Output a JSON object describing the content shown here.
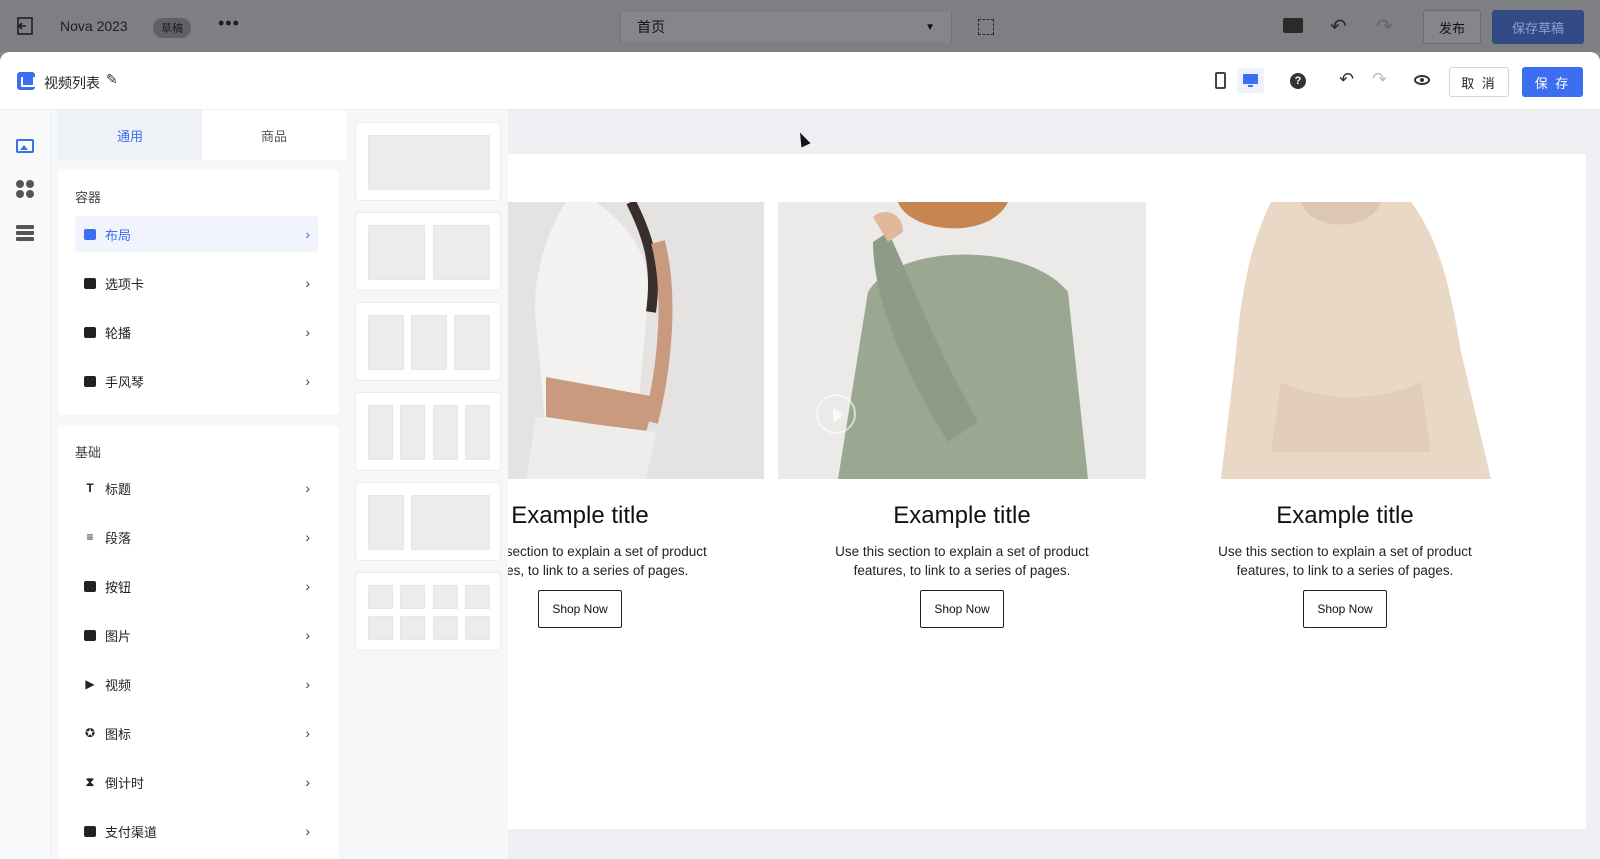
{
  "topbar": {
    "app_title": "Nova 2023",
    "draft_badge": "草稿",
    "more": "•••",
    "page_select": "首页",
    "publish": "发布",
    "save_draft": "保存草稿"
  },
  "panel_header": {
    "title": "视频列表",
    "cancel": "取 消",
    "save": "保 存"
  },
  "tabs": [
    {
      "label": "通用",
      "active": true
    },
    {
      "label": "商品",
      "active": false
    }
  ],
  "groups": [
    {
      "title": "容器",
      "items": [
        {
          "label": "布局",
          "icon": "layout-icon",
          "selected": true
        },
        {
          "label": "选项卡",
          "icon": "tabs-icon",
          "selected": false
        },
        {
          "label": "轮播",
          "icon": "carousel-icon",
          "selected": false
        },
        {
          "label": "手风琴",
          "icon": "accordion-icon",
          "selected": false
        }
      ]
    },
    {
      "title": "基础",
      "items": [
        {
          "label": "标题",
          "icon": "heading-icon"
        },
        {
          "label": "段落",
          "icon": "paragraph-icon"
        },
        {
          "label": "按钮",
          "icon": "button-icon"
        },
        {
          "label": "图片",
          "icon": "image-icon"
        },
        {
          "label": "视频",
          "icon": "video-icon"
        },
        {
          "label": "图标",
          "icon": "star-icon"
        },
        {
          "label": "倒计时",
          "icon": "hourglass-icon"
        },
        {
          "label": "支付渠道",
          "icon": "wallet-icon"
        }
      ]
    }
  ],
  "cards": [
    {
      "title": "Example title",
      "desc_line1": "Use this section to explain a set of product",
      "desc_line2": "features, to link to a series of pages.",
      "button": "Shop Now"
    },
    {
      "title": "Example title",
      "desc_line1": "Use this section to explain a set of product",
      "desc_line2": "features, to link to a series of pages.",
      "button": "Shop Now"
    },
    {
      "title": "Example title",
      "desc_line1": "Use this section to explain a set of product",
      "desc_line2": "features, to link to a series of pages.",
      "button": "Shop Now"
    }
  ],
  "colors": {
    "accent": "#3b6ef0",
    "topbar_dim": "#7d7f83"
  }
}
